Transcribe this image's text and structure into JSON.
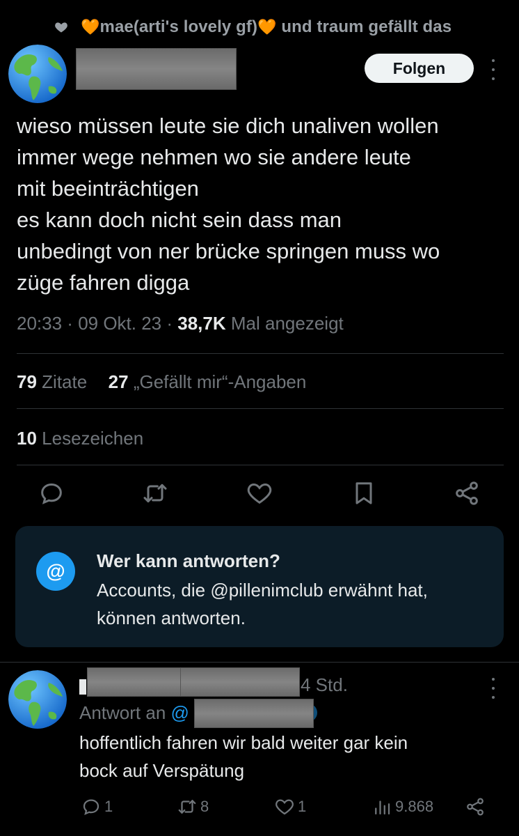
{
  "liked_by": {
    "text": "mae(arti's lovely gf)",
    "suffix": "und traum gefällt das"
  },
  "post": {
    "follow_label": "Folgen",
    "text_lines": [
      "wieso müssen leute sie dich unaliven wollen",
      "immer wege nehmen wo sie andere leute",
      "mit beeinträchtigen",
      "es kann doch nicht sein dass man",
      "unbedingt von ner brücke springen muss wo",
      "züge fahren digga"
    ],
    "time": "20:33",
    "date": "09 Okt. 23",
    "views": "38,7K",
    "views_label": "Mal angezeigt",
    "quotes_count": "79",
    "quotes_label": "Zitate",
    "likes_count": "27",
    "likes_label": "„Gefällt mir“-Angaben",
    "bookmarks_count": "10",
    "bookmarks_label": "Lesezeichen"
  },
  "reply_restriction": {
    "title": "Wer kann antworten?",
    "desc_lines": [
      "Accounts, die @pillenimclub erwähnt hat,",
      "können antworten."
    ],
    "icon": "@"
  },
  "reply": {
    "time": "4 Std.",
    "reply_to_label": "Antwort an",
    "reply_to_at": "@",
    "text_lines": [
      "hoffentlich fahren wir bald weiter gar kein",
      "bock auf Verspätung"
    ],
    "replies": "1",
    "reposts": "8",
    "likes": "1",
    "views": "9.868"
  },
  "colors": {
    "background": "#000000",
    "text": "#e7e9ea",
    "muted": "#71767b",
    "accent": "#1d9bf0",
    "orange_heart": "#f39c24",
    "info_box": "#0c1c27"
  },
  "icons": [
    "heart-icon",
    "earth-globe-avatar",
    "reply-icon",
    "repost-icon",
    "like-icon",
    "bookmark-icon",
    "share-icon",
    "views-icon",
    "more-icon",
    "at-icon"
  ]
}
